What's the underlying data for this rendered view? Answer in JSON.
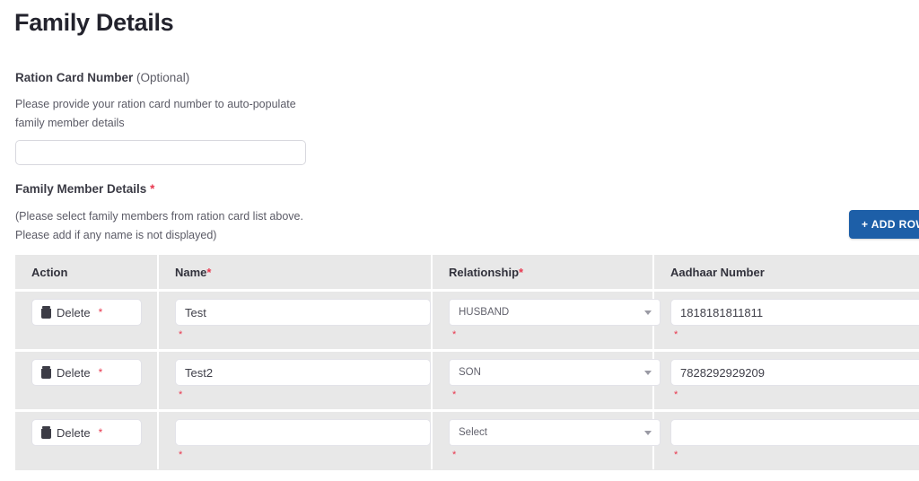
{
  "page": {
    "title": "Family Details"
  },
  "ration_card": {
    "label": "Ration Card Number",
    "optional_suffix": "(Optional)",
    "helper_line1": "Please provide your ration card number to auto-populate",
    "helper_line2": "family member details",
    "value": "",
    "placeholder": ""
  },
  "family_member_details": {
    "title": "Family Member Details",
    "required_mark": "*",
    "note_line1": "(Please select family members from ration card list above.",
    "note_line2": "Please add if any name is not displayed)"
  },
  "add_row_button": {
    "label": "+ ADD ROW",
    "color": "#1d5fa8"
  },
  "table": {
    "columns": [
      {
        "label": "Action",
        "required": ""
      },
      {
        "label": "Name",
        "required": "*"
      },
      {
        "label": "Relationship",
        "required": "*"
      },
      {
        "label": "Aadhaar Number",
        "required": ""
      }
    ],
    "delete_label": "Delete",
    "required_star": "*",
    "select_placeholder": "Select",
    "rows": [
      {
        "name": "Test",
        "relationship": "HUSBAND",
        "aadhaar": "1818181811811"
      },
      {
        "name": "Test2",
        "relationship": "SON",
        "aadhaar": "7828292929209"
      },
      {
        "name": "",
        "relationship": "Select",
        "aadhaar": ""
      }
    ]
  },
  "colors": {
    "required_red": "#e8384f",
    "table_background": "#e8e8e8",
    "accent_blue": "#1d5fa8"
  }
}
